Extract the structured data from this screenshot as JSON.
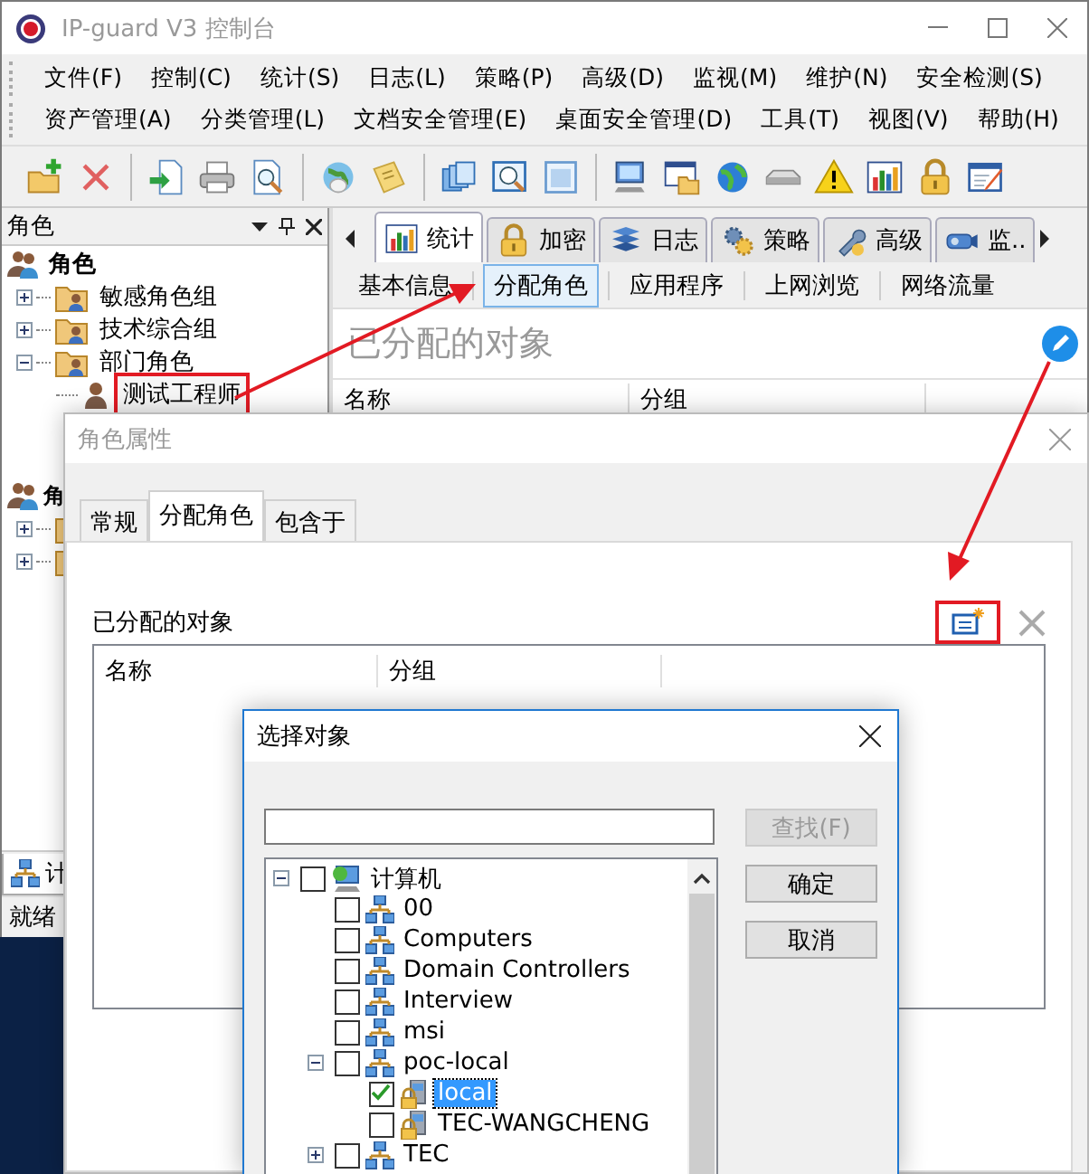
{
  "window": {
    "title": "IP-guard V3 控制台"
  },
  "menu_rows": [
    [
      "文件(F)",
      "控制(C)",
      "统计(S)",
      "日志(L)",
      "策略(P)",
      "高级(D)",
      "监视(M)",
      "维护(N)",
      "安全检测(S)"
    ],
    [
      "资产管理(A)",
      "分类管理(L)",
      "文档安全管理(E)",
      "桌面安全管理(D)",
      "工具(T)",
      "视图(V)",
      "帮助(H)"
    ]
  ],
  "left_pane": {
    "title": "角色",
    "tree": [
      {
        "label": "角色",
        "children": [
          {
            "label": "敏感角色组",
            "expanded": false
          },
          {
            "label": "技术综合组",
            "expanded": false
          },
          {
            "label": "部门角色",
            "expanded": true,
            "children": [
              {
                "label": "测试工程师",
                "highlighted": true
              }
            ]
          }
        ]
      }
    ],
    "covered_tree": {
      "label": "角",
      "children": [
        {
          "expanded": false
        },
        {
          "expanded": false
        }
      ]
    },
    "bottom_tab": "计",
    "status": "就绪"
  },
  "right_pane": {
    "tabs": [
      {
        "label": "统计",
        "selected": true
      },
      {
        "label": "加密",
        "selected": false
      },
      {
        "label": "日志",
        "selected": false
      },
      {
        "label": "策略",
        "selected": false
      },
      {
        "label": "高级",
        "selected": false
      },
      {
        "label": "监..",
        "selected": false
      }
    ],
    "subtabs": [
      {
        "label": "基本信息",
        "selected": false
      },
      {
        "label": "分配角色",
        "selected": true
      },
      {
        "label": "应用程序",
        "selected": false
      },
      {
        "label": "上网浏览",
        "selected": false
      },
      {
        "label": "网络流量",
        "selected": false
      }
    ],
    "heading": "已分配的对象",
    "columns": [
      "名称",
      "分组"
    ]
  },
  "role_dialog": {
    "title": "角色属性",
    "tabs": [
      {
        "label": "常规",
        "selected": false
      },
      {
        "label": "分配角色",
        "selected": true
      },
      {
        "label": "包含于",
        "selected": false
      }
    ],
    "section_label": "已分配的对象",
    "add_button_highlighted": true,
    "columns": [
      "名称",
      "分组"
    ]
  },
  "picker": {
    "title": "选择对象",
    "buttons": [
      {
        "label": "查找(F)",
        "disabled": true
      },
      {
        "label": "确定",
        "disabled": false
      },
      {
        "label": "取消",
        "disabled": false
      }
    ],
    "tree": [
      {
        "label": "计算机",
        "kind": "root",
        "expanded": true,
        "checked": false,
        "selected": false,
        "children": [
          {
            "label": "00",
            "kind": "group",
            "checked": false,
            "selected": false
          },
          {
            "label": "Computers",
            "kind": "group",
            "checked": false,
            "selected": false
          },
          {
            "label": "Domain Controllers",
            "kind": "group",
            "checked": false,
            "selected": false
          },
          {
            "label": "Interview",
            "kind": "group",
            "checked": false,
            "selected": false
          },
          {
            "label": "msi",
            "kind": "group",
            "checked": false,
            "selected": false
          },
          {
            "label": "poc-local",
            "kind": "group",
            "expanded": true,
            "checked": false,
            "selected": false,
            "children": [
              {
                "label": "local",
                "kind": "computer",
                "checked": true,
                "selected": true
              },
              {
                "label": "TEC-WANGCHENG",
                "kind": "computer",
                "checked": false,
                "selected": false
              }
            ]
          },
          {
            "label": "TEC",
            "kind": "group",
            "expanded": false,
            "checked": false,
            "selected": false
          }
        ]
      }
    ]
  }
}
